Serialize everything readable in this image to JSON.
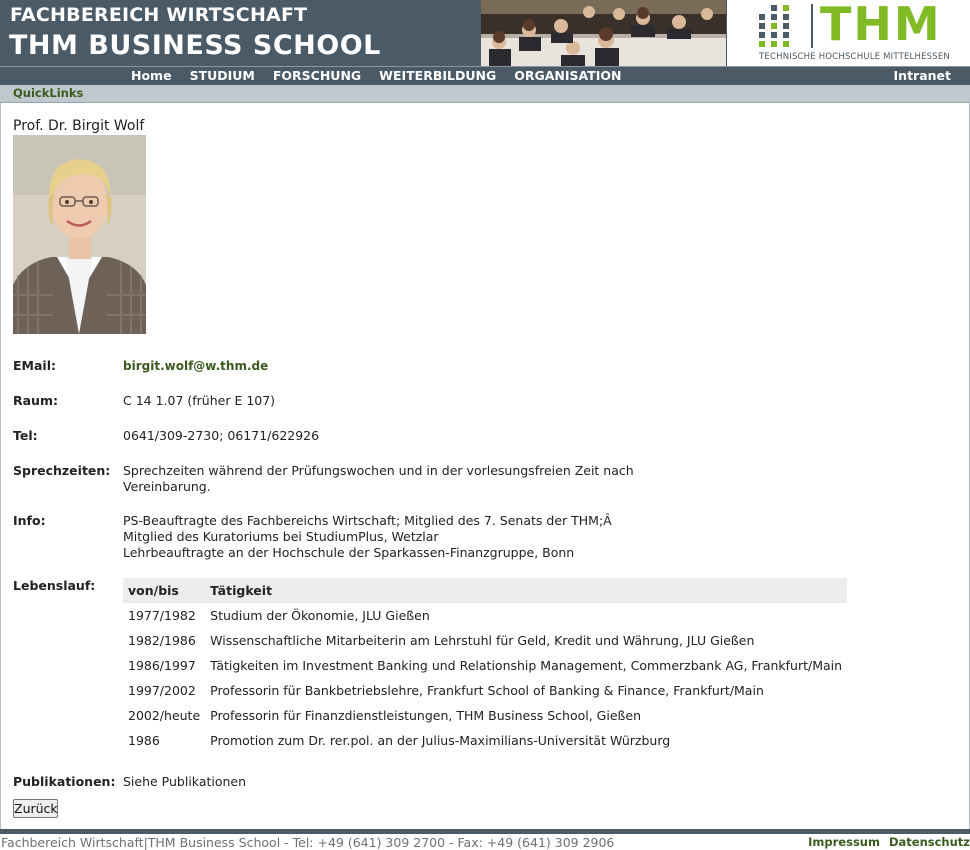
{
  "header": {
    "line1": "FACHBEREICH WIRTSCHAFT",
    "line2": "THM BUSINESS SCHOOL",
    "logo_text": "THM",
    "logo_subtitle": "TECHNISCHE HOCHSCHULE MITTELHESSEN"
  },
  "nav": {
    "items": [
      "Home",
      "STUDIUM",
      "FORSCHUNG",
      "WEITERBILDUNG",
      "ORGANISATION"
    ],
    "right": "Intranet"
  },
  "quicklinks": "QuickLinks",
  "profile": {
    "name": "Prof. Dr. Birgit Wolf",
    "email_label": "EMail:",
    "email": "birgit.wolf@w.thm.de",
    "room_label": "Raum:",
    "room": "C 14 1.07 (früher E 107)",
    "tel_label": "Tel:",
    "tel": "0641/309-2730; 06171/622926",
    "hours_label": "Sprechzeiten:",
    "hours_line1": "Sprechzeiten während der Prüfungswochen und in der vorlesungsfreien Zeit nach",
    "hours_line2": "Vereinbarung.",
    "info_label": "Info:",
    "info_line1": "PS-Beauftragte des Fachbereichs Wirtschaft; Mitglied des 7. Senats der THM;Â",
    "info_line2": "Mitglied des Kuratoriums bei StudiumPlus, Wetzlar",
    "info_line3": "Lehrbeauftragte an der Hochschule der Sparkassen-Finanzgruppe, Bonn",
    "cv_label": "Lebenslauf:",
    "cv_headers": [
      "von/bis",
      "Tätigkeit"
    ],
    "cv_rows": [
      [
        "1977/1982",
        "Studium der Ökonomie, JLU Gießen"
      ],
      [
        "1982/1986",
        "Wissenschaftliche Mitarbeiterin am Lehrstuhl für Geld, Kredit und Währung, JLU Gießen"
      ],
      [
        "1986/1997",
        "Tätigkeiten im Investment Banking und Relationship Management, Commerzbank AG, Frankfurt/Main"
      ],
      [
        "1997/2002",
        "Professorin für Bankbetriebslehre, Frankfurt School of Banking & Finance, Frankfurt/Main"
      ],
      [
        "2002/heute",
        "Professorin für Finanzdienstleistungen, THM Business School, Gießen"
      ],
      [
        "1986",
        "Promotion zum Dr. rer.pol. an der Julius-Maximilians-Universität Würzburg"
      ]
    ],
    "pub_label": "Publikationen:",
    "pub_value": "Siehe Publikationen"
  },
  "back_button": "Zurück",
  "footer": {
    "text": "Fachbereich Wirtschaft|THM Business School - Tel: +49 (641) 309 2700 - Fax: +49 (641) 309 2906",
    "links": [
      "Impressum",
      "Datenschutz"
    ]
  },
  "colors": {
    "header_bg": "#4a5a66",
    "accent_green": "#80ba24",
    "link_green": "#3b5a1e",
    "quicklinks_bg": "#bfc8cd"
  }
}
